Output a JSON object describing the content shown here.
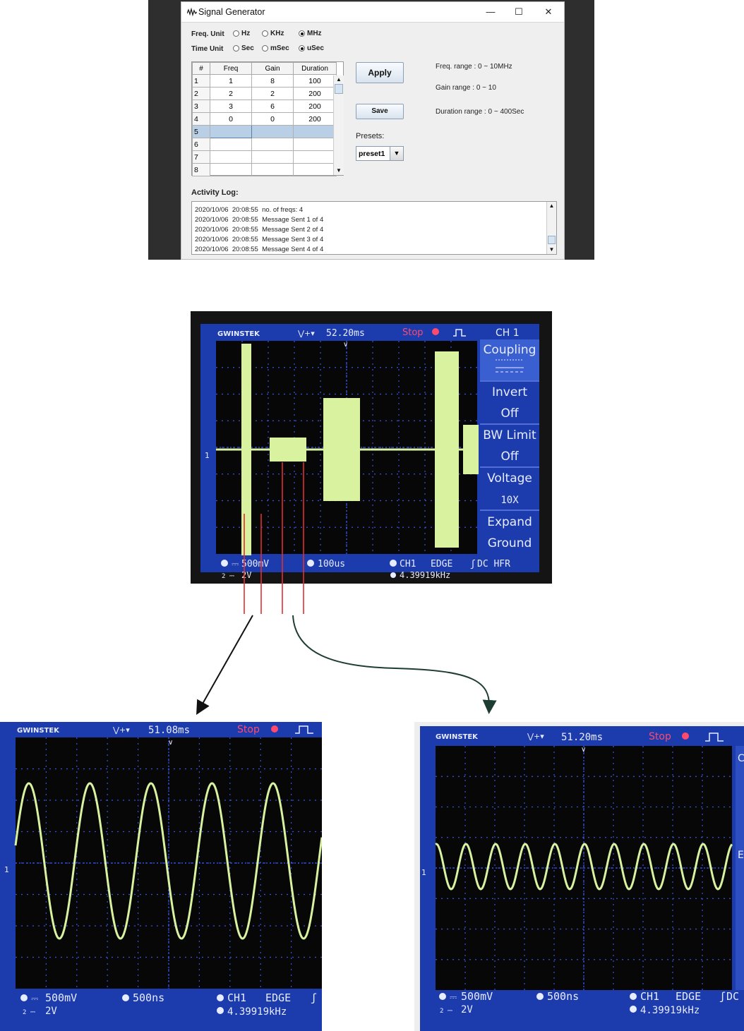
{
  "app": {
    "title": "Signal Generator",
    "window_controls": {
      "minimize": "—",
      "maximize": "☐",
      "close": "✕"
    },
    "freq_unit": {
      "label": "Freq. Unit",
      "options": [
        "Hz",
        "KHz",
        "MHz"
      ],
      "selected": "MHz"
    },
    "time_unit": {
      "label": "Time Unit",
      "options": [
        "Sec",
        "mSec",
        "uSec"
      ],
      "selected": "uSec"
    },
    "table": {
      "columns": [
        "#",
        "Freq",
        "Gain",
        "Duration"
      ],
      "rows": [
        {
          "n": "1",
          "freq": "1",
          "gain": "8",
          "duration": "100"
        },
        {
          "n": "2",
          "freq": "2",
          "gain": "2",
          "duration": "200"
        },
        {
          "n": "3",
          "freq": "3",
          "gain": "6",
          "duration": "200"
        },
        {
          "n": "4",
          "freq": "0",
          "gain": "0",
          "duration": "200"
        },
        {
          "n": "5",
          "freq": "",
          "gain": "",
          "duration": ""
        },
        {
          "n": "6",
          "freq": "",
          "gain": "",
          "duration": ""
        },
        {
          "n": "7",
          "freq": "",
          "gain": "",
          "duration": ""
        },
        {
          "n": "8",
          "freq": "",
          "gain": "",
          "duration": ""
        }
      ],
      "selected_row": "5"
    },
    "apply_label": "Apply",
    "save_label": "Save",
    "presets_label": "Presets:",
    "preset_value": "preset1",
    "freq_range": "Freq. range : 0 ~ 10MHz",
    "gain_range": "Gain range : 0 ~ 10",
    "duration_range": "Duration range : 0 ~ 400Sec",
    "activity_log_label": "Activity Log:",
    "log": [
      "2020/10/06  20:08:55  no. of freqs: 4",
      "2020/10/06  20:08:55  Message Sent 1 of 4",
      "2020/10/06  20:08:55  Message Sent 2 of 4",
      "2020/10/06  20:08:55  Message Sent 3 of 4",
      "2020/10/06  20:08:55  Message Sent 4 of 4"
    ]
  },
  "scope_main": {
    "brand": "GWINSTEK",
    "time": "52.20ms",
    "status": "Stop",
    "ch_label": "CH 1",
    "menu": [
      "Coupling",
      "Invert",
      "Off",
      "BW Limit",
      "Off",
      "Voltage",
      "10X",
      "Expand",
      "Ground"
    ],
    "ch1_scale": "500mV",
    "ch2_scale": "2V",
    "timebase": "100us",
    "trigger": "CH1",
    "edge": "EDGE",
    "coupling": "DC HFR",
    "freq": "4.39919kHz",
    "marker": "1"
  },
  "scope_left": {
    "brand": "GWINSTEK",
    "time": "51.08ms",
    "status": "Stop",
    "ch1_scale": "500mV",
    "ch2_scale": "2V",
    "timebase": "500ns",
    "trigger": "CH1",
    "edge": "EDGE",
    "freq": "4.39919kHz",
    "marker": "1"
  },
  "scope_right": {
    "brand": "GWINSTEK",
    "time": "51.20ms",
    "status": "Stop",
    "ch1_scale": "500mV",
    "ch2_scale": "2V",
    "timebase": "500ns",
    "trigger": "CH1",
    "edge": "EDGE",
    "coupling": "DC",
    "freq": "4.39919kHz",
    "marker": "1",
    "side_letters": [
      "C",
      "E"
    ]
  },
  "colors": {
    "scope_bg": "#0a0a0a",
    "trace": "#d8f2a0",
    "frame_blue": "#1b3cb0",
    "grid": "#3a5dff",
    "status_red": "#ff4a6e",
    "annotation_red": "#e03030",
    "arrow_dark": "#1d3d33"
  }
}
